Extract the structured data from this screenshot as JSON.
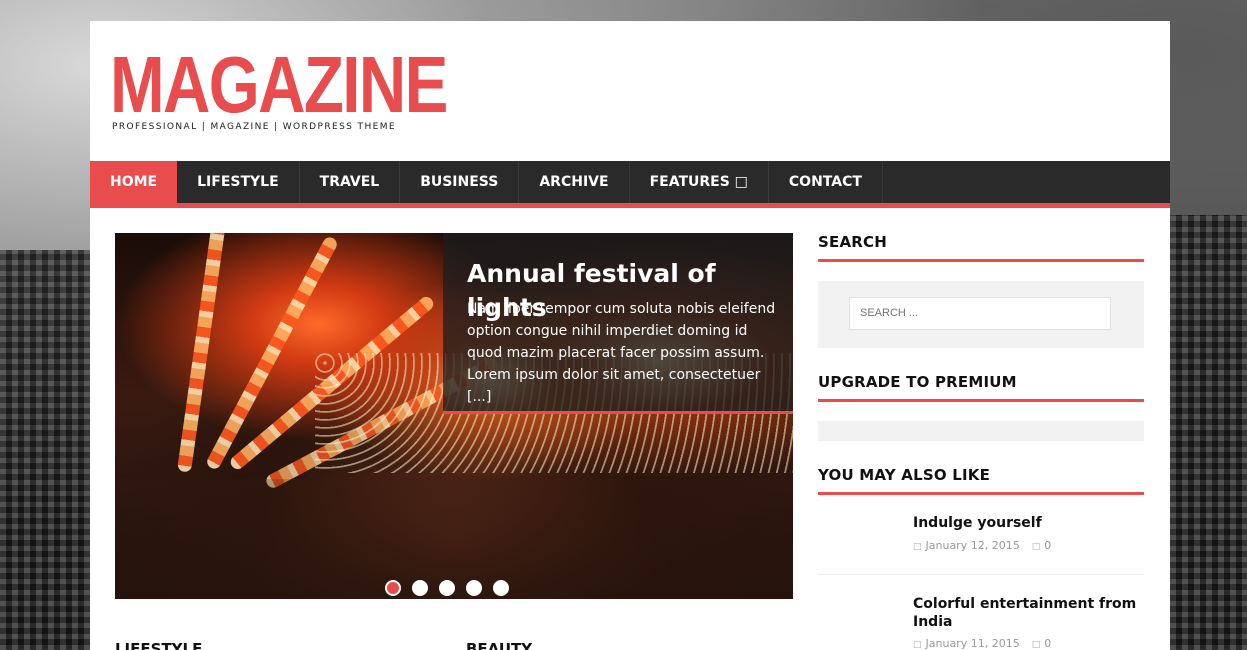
{
  "header": {
    "logo": "MAGAZINE",
    "tagline": "PROFESSIONAL | MAGAZINE | WORDPRESS THEME"
  },
  "nav": {
    "items": [
      {
        "label": "HOME"
      },
      {
        "label": "LIFESTYLE"
      },
      {
        "label": "TRAVEL"
      },
      {
        "label": "BUSINESS"
      },
      {
        "label": "ARCHIVE"
      },
      {
        "label": "FEATURES □"
      },
      {
        "label": "CONTACT"
      }
    ]
  },
  "slider": {
    "title": "Annual festival of lights",
    "excerpt": "Nam liber tempor cum soluta nobis eleifend option congue nihil imperdiet doming id quod mazim placerat facer possim assum. Lorem ipsum dolor sit amet, consectetuer [...]",
    "slide_count": 5,
    "active_slide": 1
  },
  "sections": {
    "left": "LIFESTYLE",
    "right": "BEAUTY"
  },
  "sidebar": {
    "search_title": "SEARCH",
    "search_placeholder": "SEARCH ...",
    "premium_title": "UPGRADE TO PREMIUM",
    "also_title": "YOU MAY ALSO LIKE",
    "posts": [
      {
        "title": "Indulge yourself",
        "date": "January 12, 2015",
        "comments": "0"
      },
      {
        "title": "Colorful entertainment from India",
        "date": "January 11, 2015",
        "comments": "0"
      }
    ]
  },
  "colors": {
    "accent": "#e84c4c",
    "nav_bg": "#2a2a2a",
    "widget_bg": "#f2f2f2"
  }
}
